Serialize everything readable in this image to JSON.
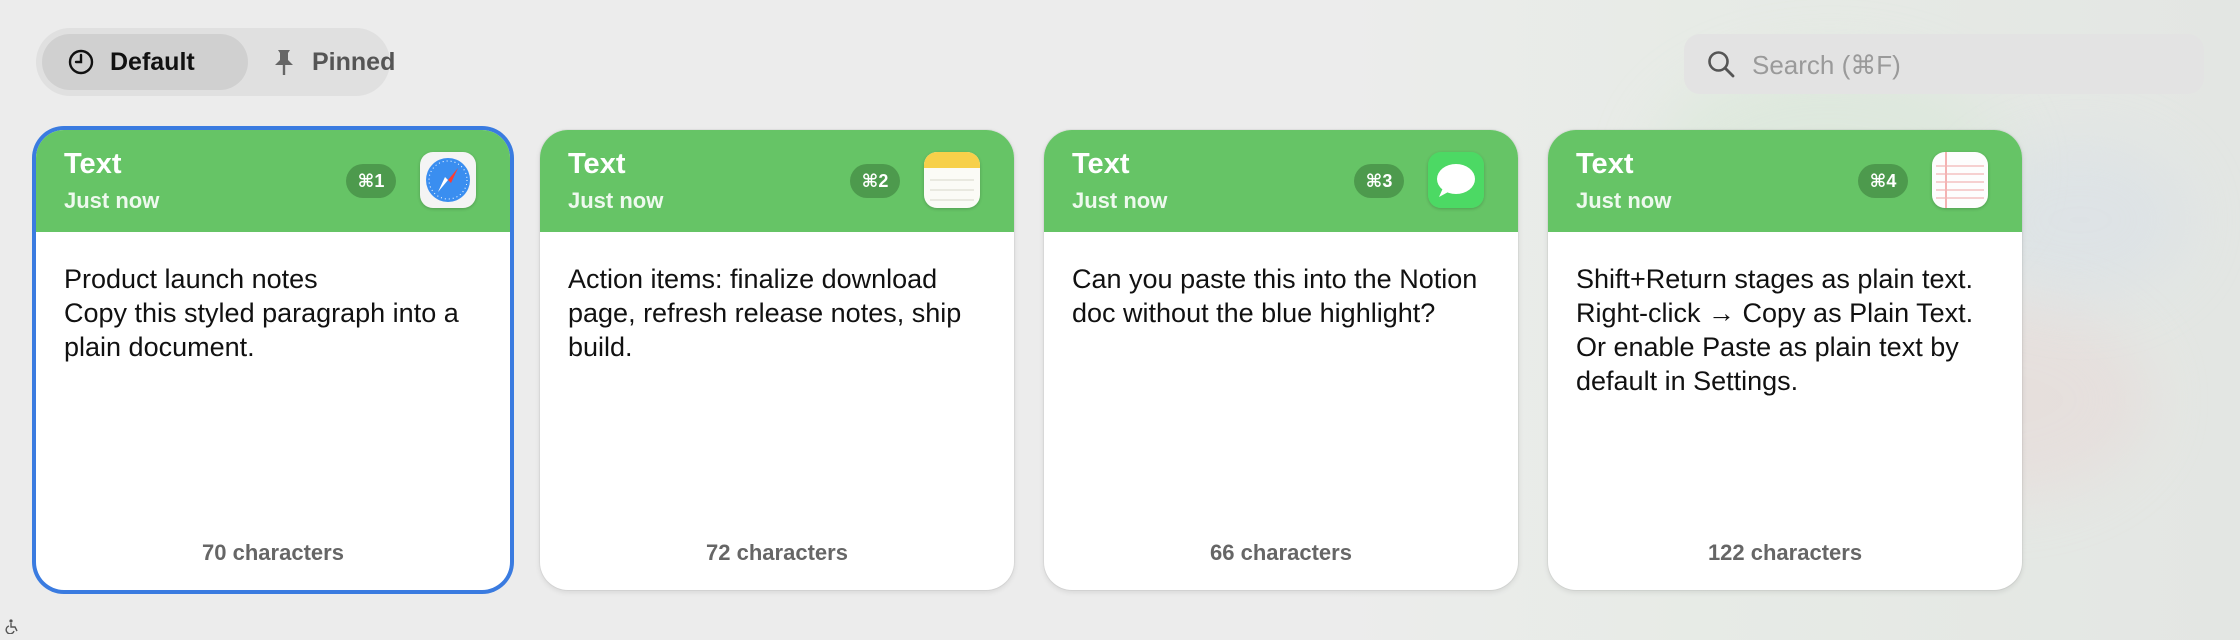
{
  "segmented": {
    "default_label": "Default",
    "pinned_label": "Pinned",
    "selected": "Default"
  },
  "search": {
    "placeholder": "Search (⌘F)"
  },
  "cards": [
    {
      "type": "Text",
      "time": "Just now",
      "shortcut": "⌘1",
      "app_icon": "safari-icon",
      "body": "Product launch notes\nCopy this styled paragraph into a plain document.",
      "count": "70 characters",
      "selected": true
    },
    {
      "type": "Text",
      "time": "Just now",
      "shortcut": "⌘2",
      "app_icon": "notes-icon",
      "body": "Action items: finalize download page, refresh release notes, ship build.",
      "count": "72 characters",
      "selected": false
    },
    {
      "type": "Text",
      "time": "Just now",
      "shortcut": "⌘3",
      "app_icon": "messages-icon",
      "body": "Can you paste this into the Notion doc without the blue highlight?",
      "count": "66 characters",
      "selected": false
    },
    {
      "type": "Text",
      "time": "Just now",
      "shortcut": "⌘4",
      "app_icon": "textedit-icon",
      "body": "Shift+Return stages as plain text. Right-click → Copy as Plain Text. Or enable Paste as plain text by default in Settings.",
      "count": "122 characters",
      "selected": false
    }
  ],
  "colors": {
    "header_green": "#66c466",
    "badge_green": "#4d9a4d",
    "selection_blue": "#3a7be0"
  }
}
